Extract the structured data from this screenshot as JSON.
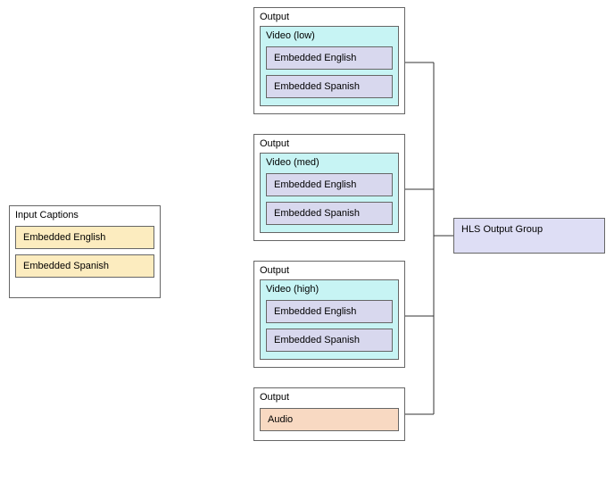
{
  "input": {
    "title": "Input Captions",
    "items": [
      "Embedded English",
      "Embedded Spanish"
    ]
  },
  "outputs": [
    {
      "title": "Output",
      "video": {
        "title": "Video (low)",
        "captions": [
          "Embedded English",
          "Embedded Spanish"
        ]
      }
    },
    {
      "title": "Output",
      "video": {
        "title": "Video (med)",
        "captions": [
          "Embedded English",
          "Embedded Spanish"
        ]
      }
    },
    {
      "title": "Output",
      "video": {
        "title": "Video (high)",
        "captions": [
          "Embedded English",
          "Embedded Spanish"
        ]
      }
    },
    {
      "title": "Output",
      "audio": "Audio"
    }
  ],
  "group": {
    "title": "HLS Output Group"
  }
}
